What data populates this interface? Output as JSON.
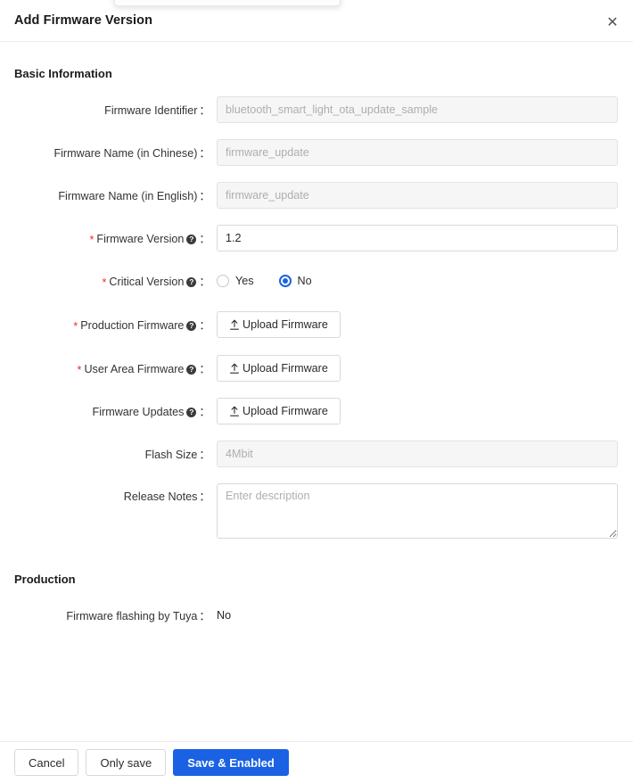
{
  "modal": {
    "title": "Add Firmware Version",
    "close_icon": "close-icon"
  },
  "sections": {
    "basic": {
      "title": "Basic Information"
    },
    "production": {
      "title": "Production"
    }
  },
  "fields": {
    "firmware_identifier": {
      "label": "Firmware Identifier",
      "placeholder": "bluetooth_smart_light_ota_update_sample",
      "value": "",
      "required": false,
      "disabled": true,
      "has_help": false
    },
    "firmware_name_cn": {
      "label": "Firmware Name (in Chinese)",
      "placeholder": "firmware_update",
      "value": "",
      "required": false,
      "disabled": true,
      "has_help": false
    },
    "firmware_name_en": {
      "label": "Firmware Name (in English)",
      "placeholder": "firmware_update",
      "value": "",
      "required": false,
      "disabled": true,
      "has_help": false
    },
    "firmware_version": {
      "label": "Firmware Version",
      "placeholder": "",
      "value": "1.2",
      "required": true,
      "disabled": false,
      "has_help": true
    },
    "critical_version": {
      "label": "Critical Version",
      "required": true,
      "has_help": true,
      "options": [
        {
          "label": "Yes",
          "value": "yes",
          "selected": false
        },
        {
          "label": "No",
          "value": "no",
          "selected": true
        }
      ],
      "selected_value": "no"
    },
    "production_firmware": {
      "label": "Production Firmware",
      "required": true,
      "has_help": true,
      "button_label": "Upload Firmware",
      "button_icon": "upload-icon"
    },
    "user_area_firmware": {
      "label": "User Area Firmware",
      "required": true,
      "has_help": true,
      "button_label": "Upload Firmware",
      "button_icon": "upload-icon"
    },
    "firmware_updates": {
      "label": "Firmware Updates",
      "required": false,
      "has_help": true,
      "button_label": "Upload Firmware",
      "button_icon": "upload-icon"
    },
    "flash_size": {
      "label": "Flash Size",
      "placeholder": "4Mbit",
      "value": "",
      "required": false,
      "disabled": true,
      "has_help": false
    },
    "release_notes": {
      "label": "Release Notes",
      "placeholder": "Enter description",
      "value": "",
      "required": false,
      "has_help": false
    },
    "firmware_flashing_by_tuya": {
      "label": "Firmware flashing by Tuya",
      "value": "No"
    }
  },
  "footer": {
    "cancel_label": "Cancel",
    "only_save_label": "Only save",
    "save_enabled_label": "Save & Enabled"
  },
  "colors": {
    "primary": "#1a62e3",
    "required_star": "#f5222d",
    "border": "#d9d9d9",
    "disabled_bg": "#f6f6f6",
    "placeholder": "#aeaeae"
  }
}
